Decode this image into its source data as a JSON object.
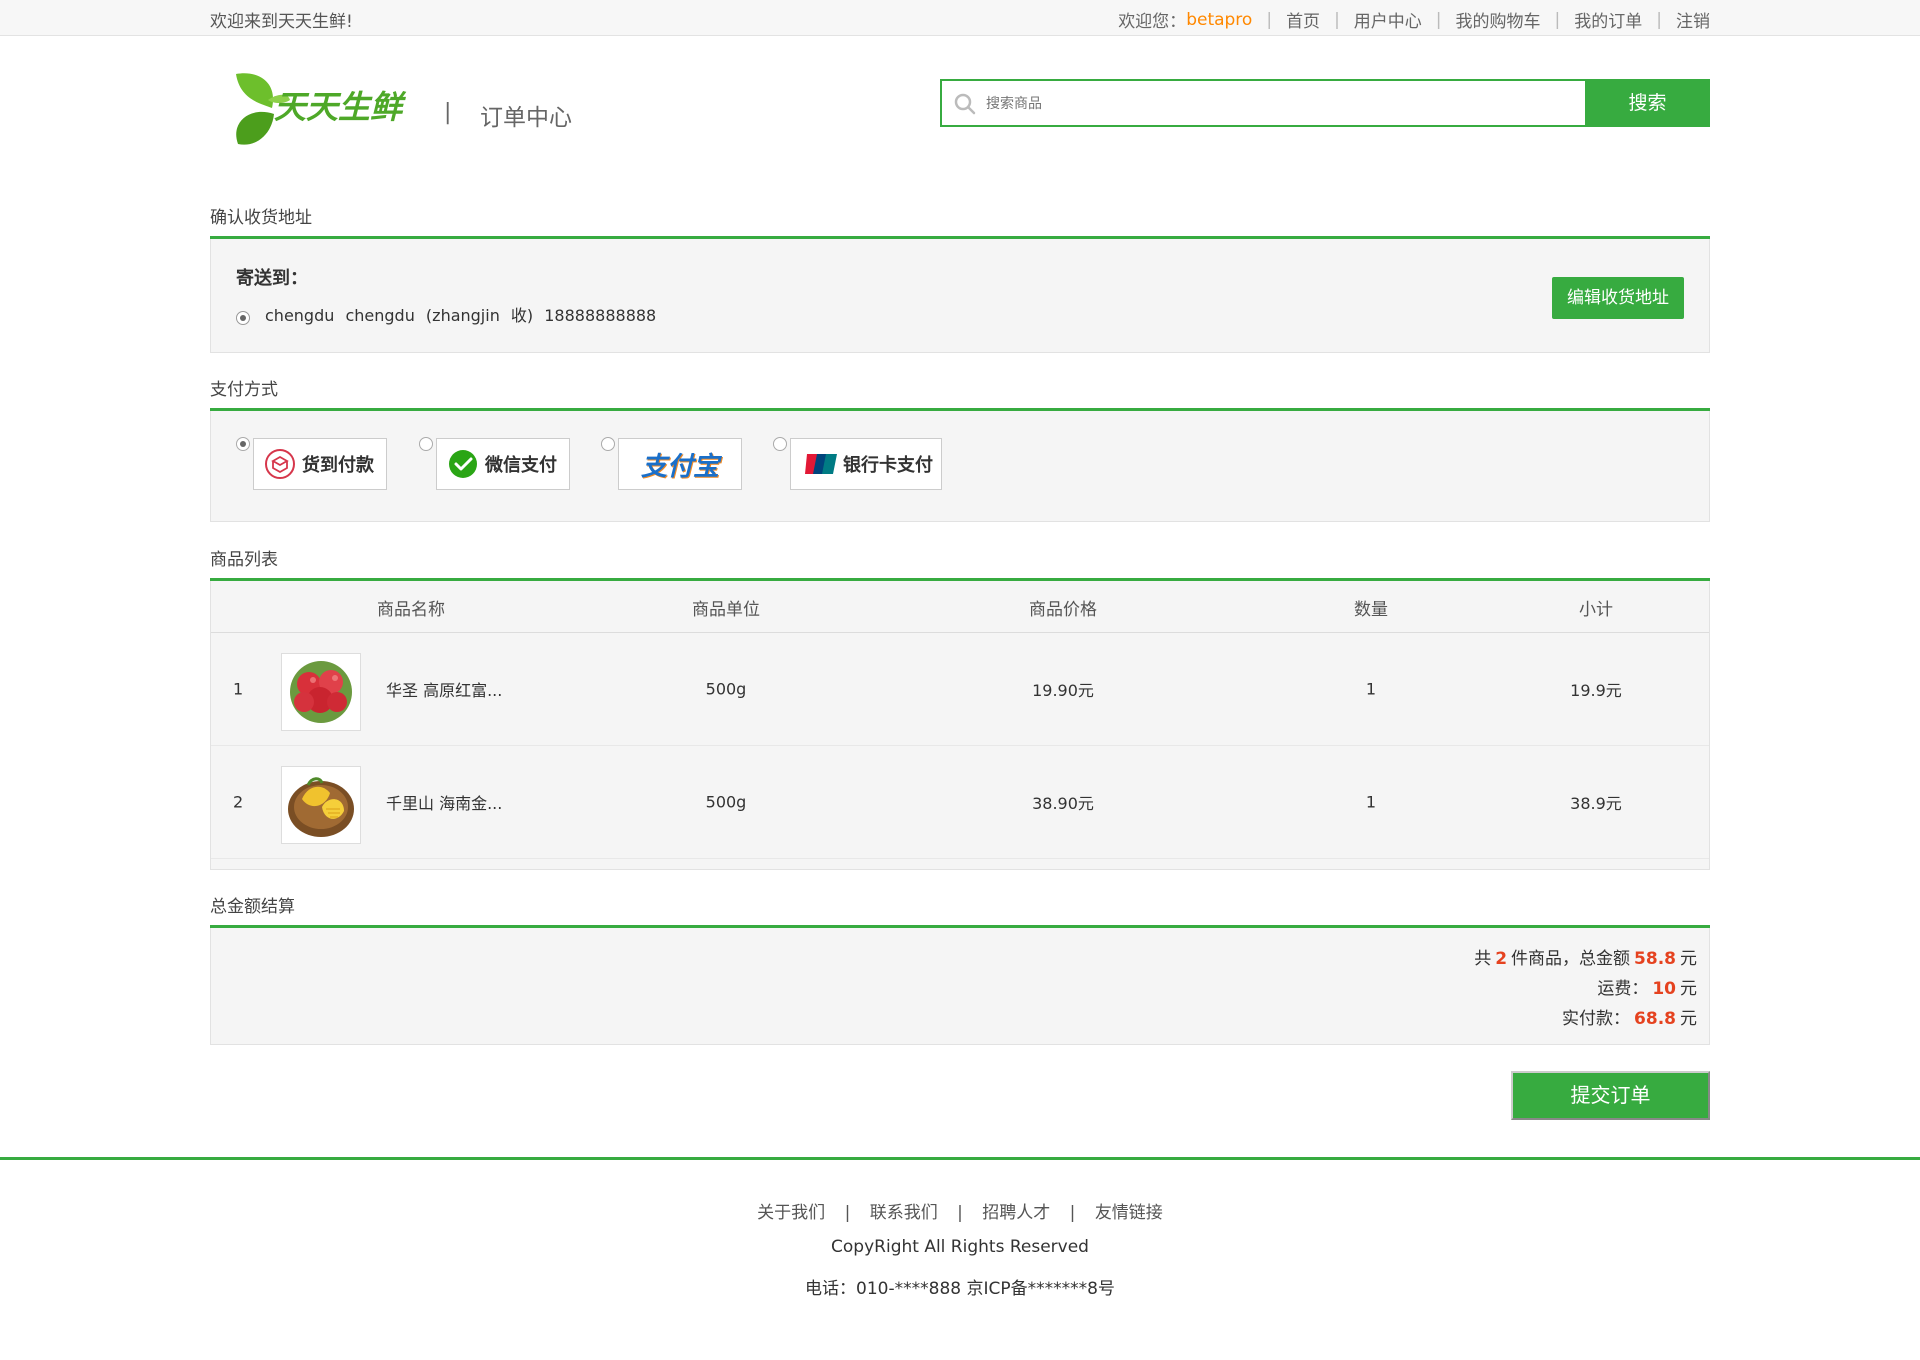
{
  "topbar": {
    "welcome": "欢迎来到天天生鲜!",
    "greeting": "欢迎您：",
    "username": "betapro",
    "links": [
      "首页",
      "用户中心",
      "我的购物车",
      "我的订单",
      "注销"
    ]
  },
  "header": {
    "logo_text": "天天生鲜",
    "divider": "|",
    "subtitle": "订单中心"
  },
  "search": {
    "placeholder": "搜索商品",
    "button": "搜索"
  },
  "address": {
    "title": "确认收货地址",
    "label": "寄送到：",
    "entry": "chengdu chengdu (zhangjin 收) 18888888888",
    "edit_button": "编辑收货地址"
  },
  "payment": {
    "title": "支付方式",
    "options": [
      {
        "label": "货到付款",
        "icon": "cod-icon",
        "checked": true
      },
      {
        "label": "微信支付",
        "icon": "wechat-pay-icon",
        "checked": false
      },
      {
        "label": "支付宝",
        "icon": "alipay-logo",
        "checked": false
      },
      {
        "label": "银行卡支付",
        "icon": "unionpay-icon",
        "checked": false
      }
    ]
  },
  "goods": {
    "title": "商品列表",
    "columns": [
      "商品名称",
      "商品单位",
      "商品价格",
      "数量",
      "小计"
    ],
    "rows": [
      {
        "index": "1",
        "image": "apple-image",
        "name": "华圣 高原红富...",
        "unit": "500g",
        "price": "19.90元",
        "qty": "1",
        "subtotal": "19.9元"
      },
      {
        "index": "2",
        "image": "mango-image",
        "name": "千里山 海南金...",
        "unit": "500g",
        "price": "38.90元",
        "qty": "1",
        "subtotal": "38.9元"
      }
    ]
  },
  "total": {
    "title": "总金额结算",
    "count_prefix": "共",
    "count": "2",
    "count_suffix": "件商品，总金额",
    "amount": "58.8",
    "yuan": "元",
    "shipping_label": "运费：",
    "shipping": "10",
    "paid_label": "实付款：",
    "paid": "68.8"
  },
  "submit_button": "提交订单",
  "footer": {
    "links": [
      "关于我们",
      "联系我们",
      "招聘人才",
      "友情链接"
    ],
    "copyright": "CopyRight All Rights Reserved",
    "tel": "电话：010-****888 京ICP备*******8号"
  },
  "colors": {
    "brand_green": "#37ab40",
    "highlight_orange": "#ff8800",
    "price_red": "#e5421f"
  }
}
